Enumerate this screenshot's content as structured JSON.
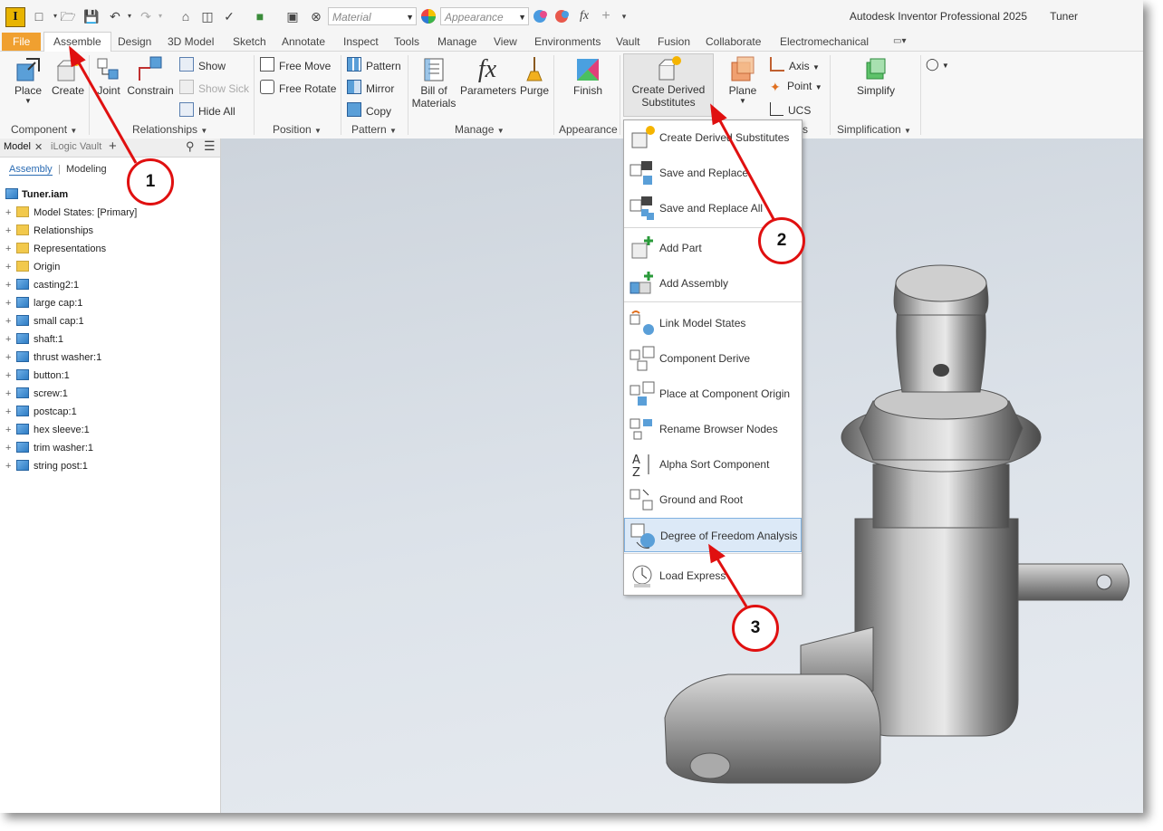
{
  "titlebar": {
    "material_placeholder": "Material",
    "appearance_placeholder": "Appearance",
    "fx_label": "fx",
    "app_title": "Autodesk Inventor Professional 2025",
    "doc_name": "Tuner"
  },
  "tabs": [
    "File",
    "Assemble",
    "Design",
    "3D Model",
    "Sketch",
    "Annotate",
    "Inspect",
    "Tools",
    "Manage",
    "View",
    "Environments",
    "Vault",
    "Fusion",
    "Collaborate",
    "Electromechanical"
  ],
  "ribbon": {
    "component": {
      "label": "Component",
      "place": "Place",
      "create": "Create"
    },
    "relationships": {
      "label": "Relationships",
      "joint": "Joint",
      "constrain": "Constrain",
      "show": "Show",
      "show_sick": "Show Sick",
      "hide_all": "Hide All"
    },
    "position": {
      "label": "Position",
      "free_move": "Free Move",
      "free_rotate": "Free Rotate"
    },
    "pattern": {
      "label": "Pattern",
      "pattern": "Pattern",
      "mirror": "Mirror",
      "copy": "Copy"
    },
    "manage": {
      "label": "Manage",
      "bom_line1": "Bill of",
      "bom_line2": "Materials",
      "parameters": "Parameters",
      "purge": "Purge"
    },
    "appearance": {
      "label": "Appearance",
      "finish": "Finish"
    },
    "derived": {
      "line1": "Create Derived",
      "line2": "Substitutes"
    },
    "work": {
      "plane": "Plane",
      "axis": "Axis",
      "point": "Point",
      "ucs": "UCS",
      "label_tail": "s"
    },
    "simplification": {
      "label": "Simplification",
      "simplify": "Simplify"
    }
  },
  "browser": {
    "tabs": [
      "Model",
      "iLogic",
      "Vault"
    ],
    "toggle_assembly": "Assembly",
    "toggle_modeling": "Modeling",
    "root": "Tuner.iam",
    "nodes": [
      {
        "label": "Model States: [Primary]",
        "icon": "folder"
      },
      {
        "label": "Relationships",
        "icon": "folder"
      },
      {
        "label": "Representations",
        "icon": "folder"
      },
      {
        "label": "Origin",
        "icon": "folder"
      },
      {
        "label": "casting2:1",
        "icon": "part"
      },
      {
        "label": "large cap:1",
        "icon": "part"
      },
      {
        "label": "small cap:1",
        "icon": "part"
      },
      {
        "label": "shaft:1",
        "icon": "part"
      },
      {
        "label": "thrust washer:1",
        "icon": "part"
      },
      {
        "label": "button:1",
        "icon": "part"
      },
      {
        "label": "screw:1",
        "icon": "part"
      },
      {
        "label": "postcap:1",
        "icon": "part"
      },
      {
        "label": "hex sleeve:1",
        "icon": "part"
      },
      {
        "label": "trim washer:1",
        "icon": "part"
      },
      {
        "label": "string post:1",
        "icon": "part"
      }
    ]
  },
  "menu": {
    "items": [
      "Create Derived Substitutes",
      "Save and Replace",
      "Save and Replace All",
      "Add Part",
      "Add Assembly",
      "Link Model States",
      "Component Derive",
      "Place at Component Origin",
      "Rename Browser Nodes",
      "Alpha Sort Component",
      "Ground and Root",
      "Degree of Freedom Analysis",
      "Load Express"
    ],
    "highlighted_index": 11
  },
  "callouts": [
    "1",
    "2",
    "3"
  ],
  "colors": {
    "file_tab": "#f0a030",
    "callout_red": "#e01010",
    "highlight": "#dce9f7"
  }
}
